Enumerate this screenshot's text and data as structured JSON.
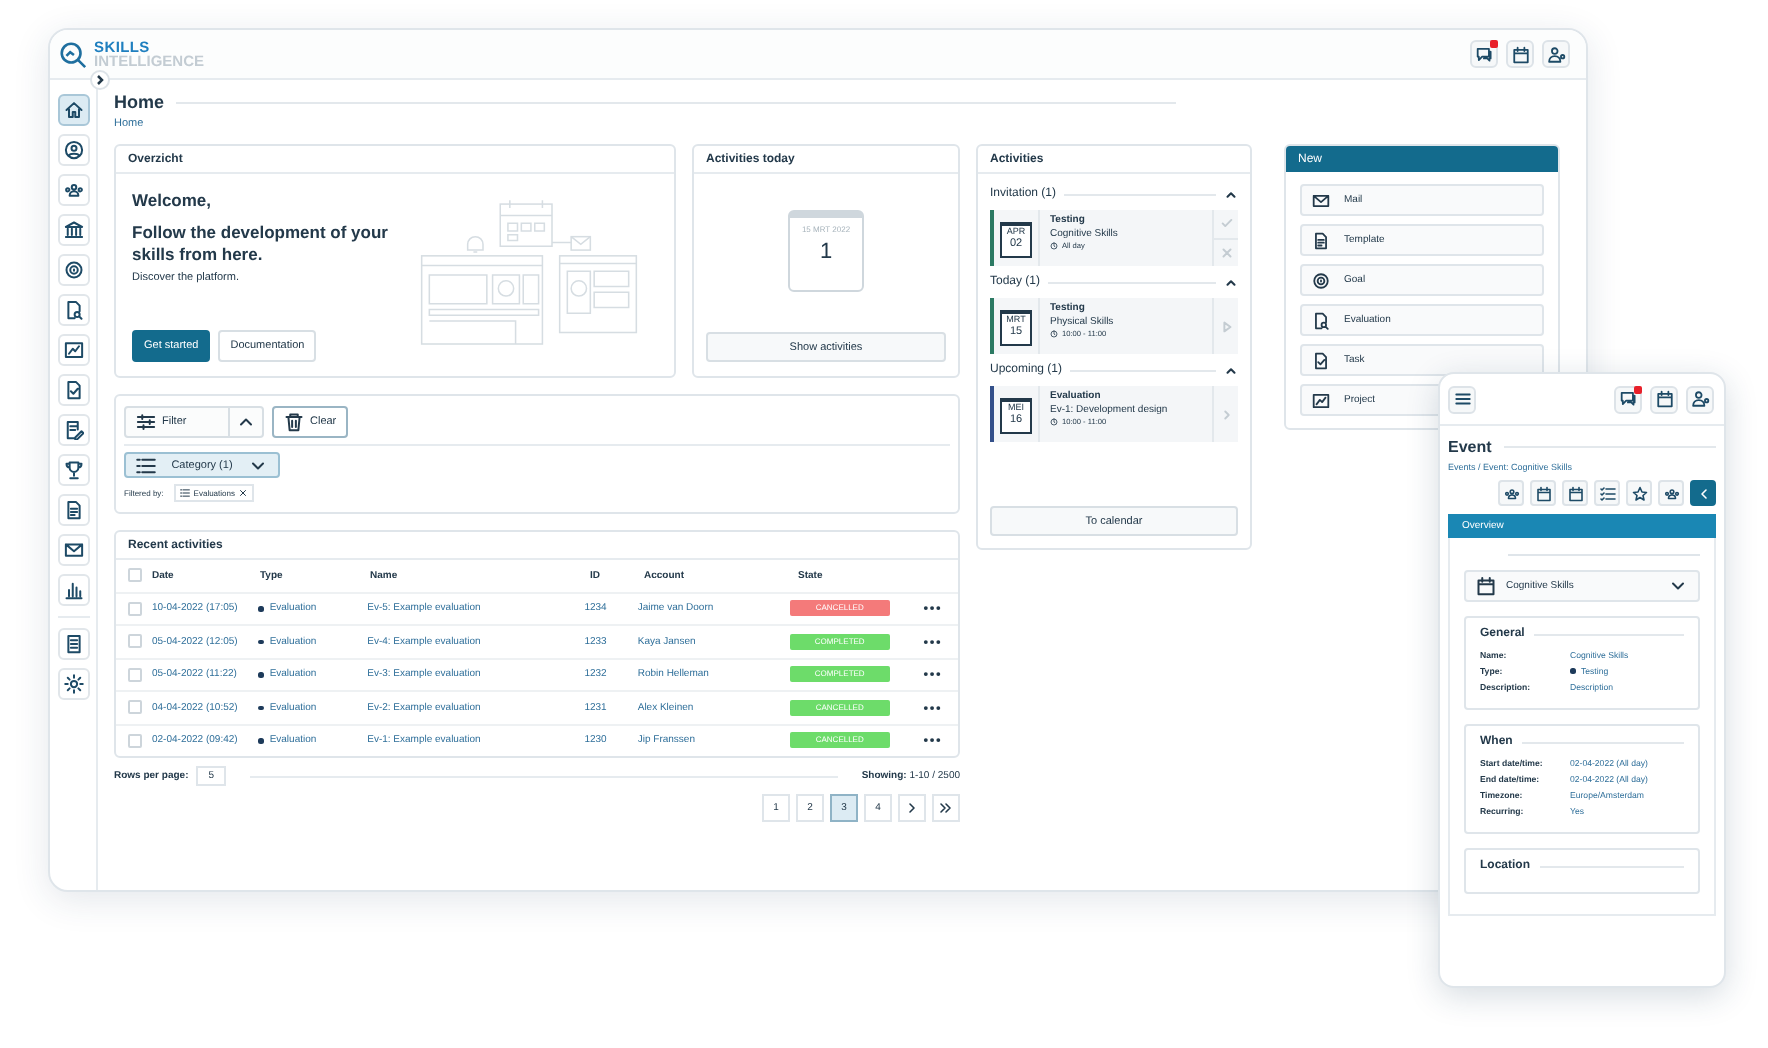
{
  "header": {
    "logo_top": "SKILLS",
    "logo_bottom": "INTELLIGENCE",
    "actions": [
      {
        "kind": "chat",
        "alert": true
      },
      {
        "kind": "calendar",
        "alert": false
      },
      {
        "kind": "user-settings",
        "alert": false
      }
    ]
  },
  "sidebar": {
    "items": [
      {
        "kind": "home",
        "selected": true
      },
      {
        "kind": "user",
        "selected": false
      },
      {
        "kind": "group",
        "selected": false
      },
      {
        "kind": "bank",
        "selected": false
      },
      {
        "kind": "target",
        "selected": false
      },
      {
        "kind": "document-search",
        "selected": false
      },
      {
        "kind": "chart-board",
        "selected": false
      },
      {
        "kind": "document-check",
        "selected": false
      },
      {
        "kind": "document-edit",
        "selected": false
      },
      {
        "kind": "trophy",
        "selected": false
      },
      {
        "kind": "document",
        "selected": false
      },
      {
        "kind": "mail",
        "selected": false
      },
      {
        "kind": "bar-chart",
        "selected": false
      }
    ],
    "bottom_items": [
      {
        "kind": "report",
        "selected": false
      },
      {
        "kind": "settings",
        "selected": false
      }
    ]
  },
  "page": {
    "title": "Home",
    "breadcrumb": "Home"
  },
  "overview": {
    "title": "Overzicht",
    "welcome": "Welcome,",
    "headline": "Follow the development of your skills from here.",
    "text": "Discover the platform.",
    "buttons": [
      {
        "label": "Get started",
        "kind": "primary"
      },
      {
        "label": "Documentation",
        "kind": "secondary"
      }
    ]
  },
  "activities_today": {
    "title": "Activities today",
    "date": "15 MRT 2022",
    "count": "1",
    "button": "Show activities"
  },
  "filter": {
    "filter_button": "Filter",
    "expanded": true,
    "clear_button": "Clear",
    "category": "Category (1)",
    "filtered_by": "Filtered by:",
    "chips": [
      "Evaluations"
    ]
  },
  "recent": {
    "title": "Recent activities",
    "columns": [
      "Date",
      "Type",
      "Name",
      "ID",
      "Account",
      "State"
    ],
    "header_checked": false,
    "rows": [
      {
        "checked": false,
        "date": "10-04-2022 (17:05)",
        "type": "Evaluation",
        "name": "Ev-5: Example evaluation",
        "id": "1234",
        "account": "Jaime van Doorn",
        "state": "CANCELLED",
        "color": "#f47a7a"
      },
      {
        "checked": false,
        "date": "05-04-2022 (12:05)",
        "type": "Evaluation",
        "name": "Ev-4: Example evaluation",
        "id": "1233",
        "account": "Kaya Jansen",
        "state": "COMPLETED",
        "color": "#6ddc6a"
      },
      {
        "checked": false,
        "date": "05-04-2022 (11:22)",
        "type": "Evaluation",
        "name": "Ev-3: Example evaluation",
        "id": "1232",
        "account": "Robin Helleman",
        "state": "COMPLETED",
        "color": "#6ddc6a"
      },
      {
        "checked": false,
        "date": "04-04-2022 (10:52)",
        "type": "Evaluation",
        "name": "Ev-2: Example evaluation",
        "id": "1231",
        "account": "Alex Kleinen",
        "state": "CANCELLED",
        "color": "#6ddc6a"
      },
      {
        "checked": false,
        "date": "02-04-2022 (09:42)",
        "type": "Evaluation",
        "name": "Ev-1: Example evaluation",
        "id": "1230",
        "account": "Jip Franssen",
        "state": "CANCELLED",
        "color": "#6ddc6a"
      }
    ],
    "rows_per_page_label": "Rows per page:",
    "rows_per_page": "5",
    "showing": "**Showing:** 1-10 / 2500",
    "pages": [
      {
        "label": "1",
        "selected": false
      },
      {
        "label": "2",
        "selected": false
      },
      {
        "label": "3",
        "selected": true
      },
      {
        "label": "4",
        "selected": false
      }
    ]
  },
  "activities": {
    "title": "Activities",
    "groups": [
      {
        "title": "Invitation (1)",
        "expanded": true,
        "items": [
          {
            "kind": "invitation",
            "month": "APR",
            "day": "02",
            "title": "Testing",
            "subtitle": "Cognitive Skills",
            "time": "All day",
            "color": "#2c7a63"
          }
        ]
      },
      {
        "title": "Today (1)",
        "expanded": true,
        "items": [
          {
            "kind": "current",
            "month": "MRT",
            "day": "15",
            "title": "Testing",
            "subtitle": "Physical Skills",
            "time": "10:00 - 11:00",
            "color": "#2c7a63"
          }
        ]
      },
      {
        "title": "Upcoming (1)",
        "expanded": true,
        "items": [
          {
            "kind": "upcoming",
            "month": "MEI",
            "day": "16",
            "title": "Evaluation",
            "subtitle": "Ev-1: Development design",
            "time": "10:00 - 11:00",
            "color": "#34508a"
          }
        ]
      }
    ],
    "button": "To calendar"
  },
  "new_panel": {
    "title": "New",
    "items": [
      {
        "kind": "mail",
        "label": "Mail"
      },
      {
        "kind": "document",
        "label": "Template"
      },
      {
        "kind": "target",
        "label": "Goal"
      },
      {
        "kind": "document-search",
        "label": "Evaluation"
      },
      {
        "kind": "document-check",
        "label": "Task"
      },
      {
        "kind": "chart-board",
        "label": "Project"
      }
    ]
  },
  "mobile": {
    "actions": [
      {
        "kind": "chat",
        "alert": true
      },
      {
        "kind": "calendar",
        "alert": false
      },
      {
        "kind": "user-settings",
        "alert": false
      }
    ],
    "title": "Event",
    "breadcrumb": "Events / Event: Cognitive Skills",
    "tools": [
      {
        "kind": "group",
        "selected": false
      },
      {
        "kind": "calendar",
        "selected": false
      },
      {
        "kind": "calendar",
        "selected": false
      },
      {
        "kind": "checklist",
        "selected": false
      },
      {
        "kind": "star",
        "selected": false
      },
      {
        "kind": "group",
        "selected": false
      },
      {
        "kind": "chevron-left",
        "selected": true
      }
    ],
    "tab": "Overview",
    "select": "Cognitive Skills",
    "sections": [
      {
        "title": "General",
        "fields": [
          {
            "kind": "text",
            "label": "Name:",
            "value": "Cognitive Skills"
          },
          {
            "kind": "dot",
            "label": "Type:",
            "value": "Testing"
          },
          {
            "kind": "text",
            "label": "Description:",
            "value": "Description"
          }
        ]
      },
      {
        "title": "When",
        "fields": [
          {
            "kind": "text",
            "label": "Start date/time:",
            "value": "02-04-2022 (All day)"
          },
          {
            "kind": "text",
            "label": "End date/time:",
            "value": "02-04-2022 (All day)"
          },
          {
            "kind": "text",
            "label": "Timezone:",
            "value": "Europe/Amsterdam"
          },
          {
            "kind": "text",
            "label": "Recurring:",
            "value": "Yes"
          }
        ]
      },
      {
        "title": "Location"
      }
    ]
  }
}
